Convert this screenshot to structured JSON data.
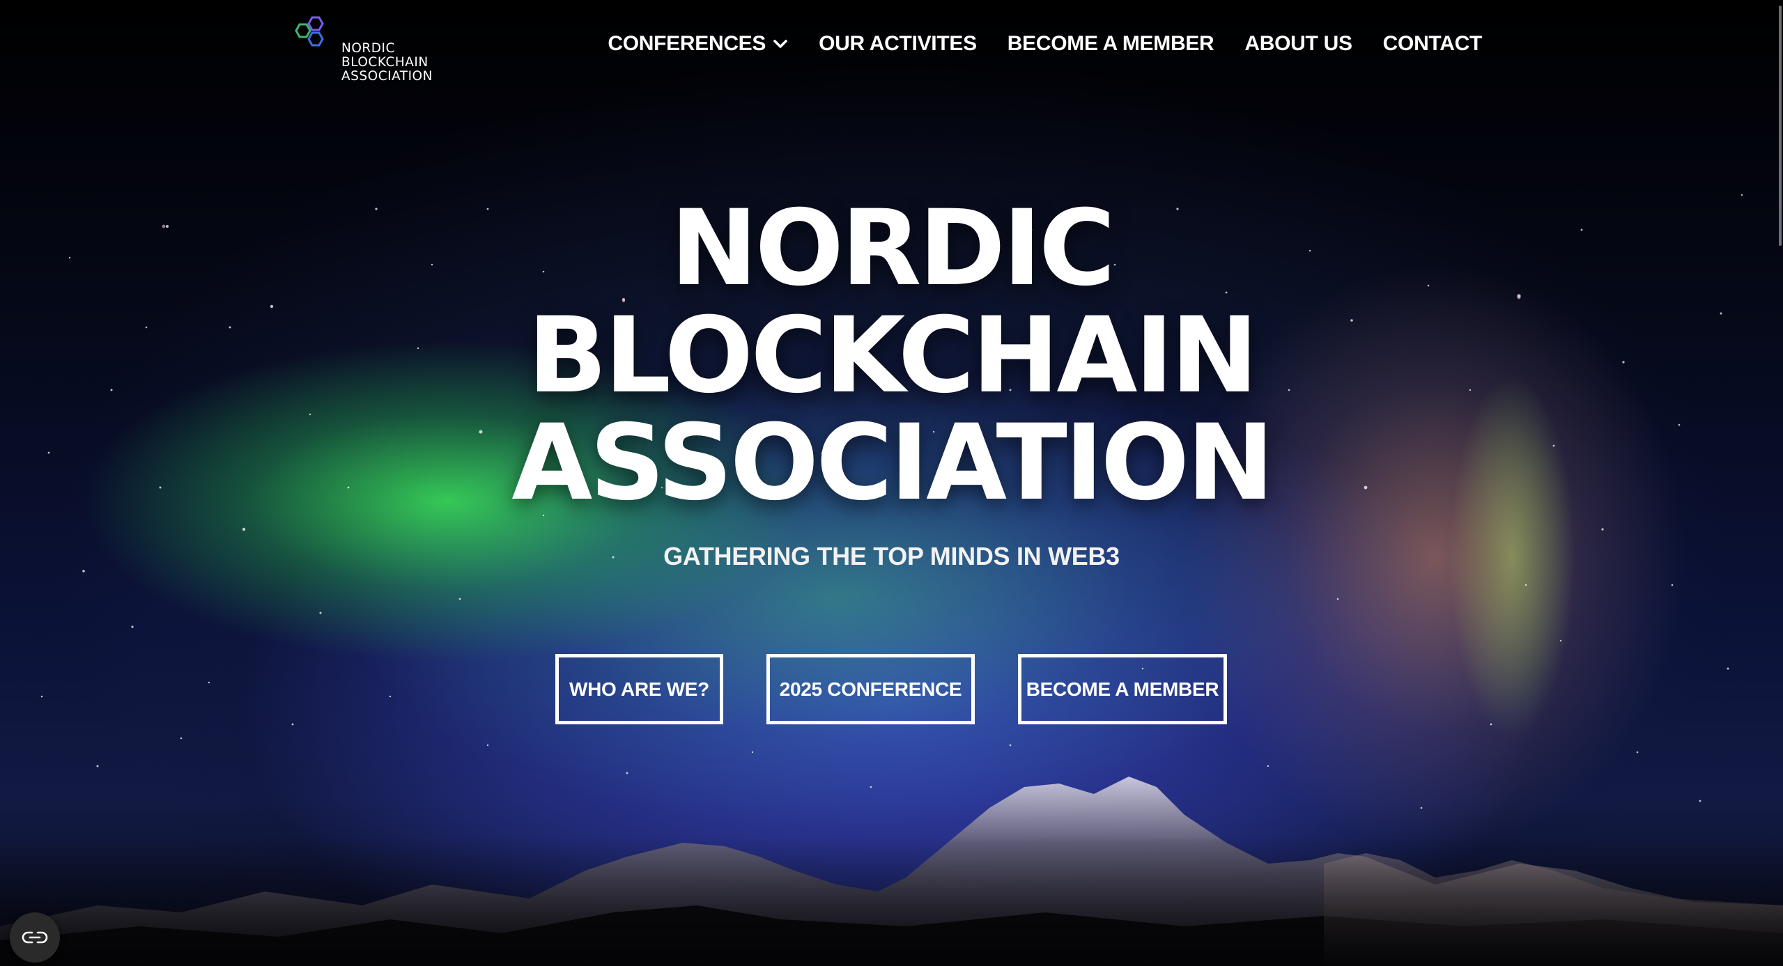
{
  "logo": {
    "line1": "NORDIC",
    "line2": "BLOCKCHAIN",
    "line3": "ASSOCIATION",
    "colors": {
      "green": "#3fb86a",
      "purple": "#7b5cf0",
      "blue": "#3f6fe0"
    }
  },
  "nav": {
    "items": [
      {
        "label": "CONFERENCES",
        "has_dropdown": true
      },
      {
        "label": "OUR ACTIVITES"
      },
      {
        "label": "BECOME A MEMBER"
      },
      {
        "label": "ABOUT US"
      },
      {
        "label": "CONTACT"
      }
    ]
  },
  "hero": {
    "title_lines": [
      "NORDIC",
      "BLOCKCHAIN",
      "ASSOCIATION"
    ],
    "subtitle": "GATHERING THE TOP MINDS IN WEB3",
    "buttons": [
      "WHO ARE WE?",
      "2025 CONFERENCE",
      "BECOME A MEMBER"
    ]
  },
  "icons": {
    "dropdown": "chevron-down-icon",
    "accessibility": "accessibility-toggle-icon"
  },
  "colors": {
    "text": "#ffffff",
    "background": "#000000"
  }
}
